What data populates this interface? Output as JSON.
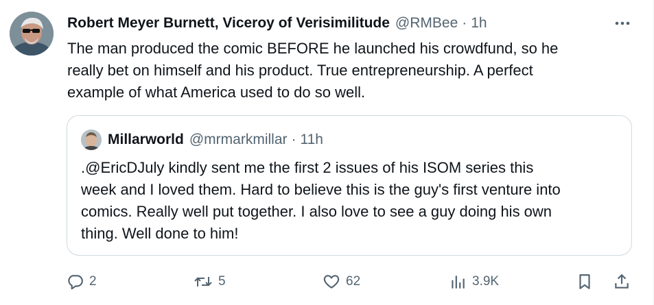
{
  "tweet": {
    "author_name": "Robert Meyer Burnett, Viceroy of Verisimilitude",
    "handle": "@RMBee",
    "separator": "·",
    "time": "1h",
    "text": "The man produced the comic BEFORE he launched his crowdfund, so he\nreally bet on himself and his product. True entrepreneurship. A perfect\nexample of what America used to do so well."
  },
  "quoted_tweet": {
    "author_name": "Millarworld",
    "handle": "@mrmarkmillar",
    "separator": "·",
    "time": "11h",
    "text": ".@EricDJuly kindly sent me the first 2 issues of his ISOM series this\nweek and I loved them. Hard to believe this is the guy's first venture into\ncomics. Really well put together. I also love to see a guy doing his own\nthing. Well done to him!"
  },
  "actions": {
    "replies": "2",
    "reposts": "5",
    "likes": "62",
    "views": "3.9K"
  },
  "icons": [
    "more-icon",
    "reply-icon",
    "repost-icon",
    "like-icon",
    "views-icon",
    "bookmark-icon",
    "share-icon"
  ],
  "colors": {
    "text": "#0f1419",
    "secondary": "#536471",
    "border": "#cfd9de"
  }
}
